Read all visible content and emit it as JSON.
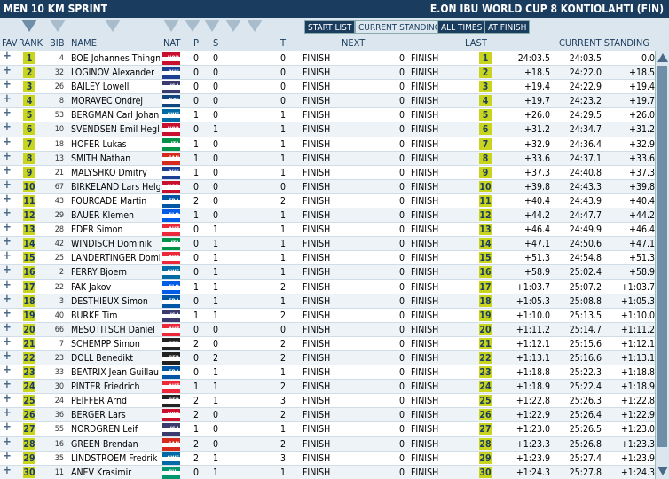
{
  "title_left": "MEN 10 KM SPRINT",
  "title_right": "E.ON IBU WORLD CUP 8 KONTIOLAHTI (FIN)",
  "tabs": [
    "START LIST",
    "CURRENT STANDING",
    "ALL TIMES",
    "AT FINISH"
  ],
  "columns": {
    "fav": "FAV",
    "rank": "RANK",
    "bib": "BIB",
    "name": "NAME",
    "nat": "NAT",
    "p": "P",
    "s": "S",
    "t": "T",
    "next": "NEXT",
    "last": "LAST",
    "current": "CURRENT STANDING"
  },
  "rows": [
    {
      "rank": "1",
      "bib": "4",
      "name": "BOE Johannes Thingn",
      "nat": "NOR",
      "p": "0",
      "s": "0",
      "t": "0",
      "next": "FINISH",
      "nv": "0",
      "last": "FINISH",
      "lrank": "1",
      "ltime": "24:03.5",
      "ctime": "24:03.5",
      "cdiff": "0.0"
    },
    {
      "rank": "2",
      "bib": "32",
      "name": "LOGINOV Alexander",
      "nat": "RUS",
      "p": "0",
      "s": "0",
      "t": "0",
      "next": "FINISH",
      "nv": "0",
      "last": "FINISH",
      "lrank": "2",
      "ltime": "+18.5",
      "ctime": "24:22.0",
      "cdiff": "+18.5"
    },
    {
      "rank": "3",
      "bib": "26",
      "name": "BAILEY Lowell",
      "nat": "USA",
      "p": "0",
      "s": "0",
      "t": "0",
      "next": "FINISH",
      "nv": "0",
      "last": "FINISH",
      "lrank": "3",
      "ltime": "+19.4",
      "ctime": "24:22.9",
      "cdiff": "+19.4"
    },
    {
      "rank": "4",
      "bib": "8",
      "name": "MORAVEC Ondrej",
      "nat": "CZE",
      "p": "0",
      "s": "0",
      "t": "0",
      "next": "FINISH",
      "nv": "0",
      "last": "FINISH",
      "lrank": "4",
      "ltime": "+19.7",
      "ctime": "24:23.2",
      "cdiff": "+19.7"
    },
    {
      "rank": "5",
      "bib": "53",
      "name": "BERGMAN Carl Johan",
      "nat": "SWE",
      "p": "1",
      "s": "0",
      "t": "1",
      "next": "FINISH",
      "nv": "0",
      "last": "FINISH",
      "lrank": "5",
      "ltime": "+26.0",
      "ctime": "24:29.5",
      "cdiff": "+26.0"
    },
    {
      "rank": "6",
      "bib": "10",
      "name": "SVENDSEN Emil Hegle",
      "nat": "NOR",
      "p": "0",
      "s": "1",
      "t": "1",
      "next": "FINISH",
      "nv": "0",
      "last": "FINISH",
      "lrank": "6",
      "ltime": "+31.2",
      "ctime": "24:34.7",
      "cdiff": "+31.2"
    },
    {
      "rank": "7",
      "bib": "18",
      "name": "HOFER Lukas",
      "nat": "ITA",
      "p": "1",
      "s": "0",
      "t": "1",
      "next": "FINISH",
      "nv": "0",
      "last": "FINISH",
      "lrank": "7",
      "ltime": "+32.9",
      "ctime": "24:36.4",
      "cdiff": "+32.9"
    },
    {
      "rank": "8",
      "bib": "13",
      "name": "SMITH Nathan",
      "nat": "CAN",
      "p": "1",
      "s": "0",
      "t": "1",
      "next": "FINISH",
      "nv": "0",
      "last": "FINISH",
      "lrank": "8",
      "ltime": "+33.6",
      "ctime": "24:37.1",
      "cdiff": "+33.6"
    },
    {
      "rank": "9",
      "bib": "21",
      "name": "MALYSHKO Dmitry",
      "nat": "RUS",
      "p": "1",
      "s": "0",
      "t": "1",
      "next": "FINISH",
      "nv": "0",
      "last": "FINISH",
      "lrank": "9",
      "ltime": "+37.3",
      "ctime": "24:40.8",
      "cdiff": "+37.3"
    },
    {
      "rank": "10",
      "bib": "67",
      "name": "BIRKELAND Lars Helg",
      "nat": "NOR",
      "p": "0",
      "s": "0",
      "t": "0",
      "next": "FINISH",
      "nv": "0",
      "last": "FINISH",
      "lrank": "10",
      "ltime": "+39.8",
      "ctime": "24:43.3",
      "cdiff": "+39.8"
    },
    {
      "rank": "11",
      "bib": "43",
      "name": "FOURCADE Martin",
      "nat": "FRA",
      "p": "2",
      "s": "0",
      "t": "2",
      "next": "FINISH",
      "nv": "0",
      "last": "FINISH",
      "lrank": "11",
      "ltime": "+40.4",
      "ctime": "24:43.9",
      "cdiff": "+40.4"
    },
    {
      "rank": "12",
      "bib": "29",
      "name": "BAUER Klemen",
      "nat": "SLO",
      "p": "1",
      "s": "0",
      "t": "1",
      "next": "FINISH",
      "nv": "0",
      "last": "FINISH",
      "lrank": "12",
      "ltime": "+44.2",
      "ctime": "24:47.7",
      "cdiff": "+44.2"
    },
    {
      "rank": "13",
      "bib": "28",
      "name": "EDER Simon",
      "nat": "AUT",
      "p": "0",
      "s": "1",
      "t": "1",
      "next": "FINISH",
      "nv": "0",
      "last": "FINISH",
      "lrank": "13",
      "ltime": "+46.4",
      "ctime": "24:49.9",
      "cdiff": "+46.4"
    },
    {
      "rank": "14",
      "bib": "42",
      "name": "WINDISCH Dominik",
      "nat": "ITA",
      "p": "0",
      "s": "1",
      "t": "1",
      "next": "FINISH",
      "nv": "0",
      "last": "FINISH",
      "lrank": "14",
      "ltime": "+47.1",
      "ctime": "24:50.6",
      "cdiff": "+47.1"
    },
    {
      "rank": "15",
      "bib": "25",
      "name": "LANDERTINGER Domir",
      "nat": "AUT",
      "p": "0",
      "s": "1",
      "t": "1",
      "next": "FINISH",
      "nv": "0",
      "last": "FINISH",
      "lrank": "15",
      "ltime": "+51.3",
      "ctime": "24:54.8",
      "cdiff": "+51.3"
    },
    {
      "rank": "16",
      "bib": "2",
      "name": "FERRY Bjoern",
      "nat": "SWE",
      "p": "0",
      "s": "1",
      "t": "1",
      "next": "FINISH",
      "nv": "0",
      "last": "FINISH",
      "lrank": "16",
      "ltime": "+58.9",
      "ctime": "25:02.4",
      "cdiff": "+58.9"
    },
    {
      "rank": "17",
      "bib": "22",
      "name": "FAK Jakov",
      "nat": "SLO",
      "p": "1",
      "s": "1",
      "t": "2",
      "next": "FINISH",
      "nv": "0",
      "last": "FINISH",
      "lrank": "17",
      "ltime": "+1:03.7",
      "ctime": "25:07.2",
      "cdiff": "+1:03.7"
    },
    {
      "rank": "18",
      "bib": "3",
      "name": "DESTHIEUX Simon",
      "nat": "FRA",
      "p": "0",
      "s": "1",
      "t": "1",
      "next": "FINISH",
      "nv": "0",
      "last": "FINISH",
      "lrank": "18",
      "ltime": "+1:05.3",
      "ctime": "25:08.8",
      "cdiff": "+1:05.3"
    },
    {
      "rank": "19",
      "bib": "40",
      "name": "BURKE Tim",
      "nat": "USA",
      "p": "1",
      "s": "1",
      "t": "2",
      "next": "FINISH",
      "nv": "0",
      "last": "FINISH",
      "lrank": "19",
      "ltime": "+1:10.0",
      "ctime": "25:13.5",
      "cdiff": "+1:10.0"
    },
    {
      "rank": "20",
      "bib": "66",
      "name": "MESOTITSCH Daniel",
      "nat": "AUT",
      "p": "0",
      "s": "0",
      "t": "0",
      "next": "FINISH",
      "nv": "0",
      "last": "FINISH",
      "lrank": "20",
      "ltime": "+1:11.2",
      "ctime": "25:14.7",
      "cdiff": "+1:11.2"
    },
    {
      "rank": "21",
      "bib": "7",
      "name": "SCHEMPP Simon",
      "nat": "GER",
      "p": "2",
      "s": "0",
      "t": "2",
      "next": "FINISH",
      "nv": "0",
      "last": "FINISH",
      "lrank": "21",
      "ltime": "+1:12.1",
      "ctime": "25:15.6",
      "cdiff": "+1:12.1"
    },
    {
      "rank": "22",
      "bib": "23",
      "name": "DOLL Benedikt",
      "nat": "GER",
      "p": "0",
      "s": "2",
      "t": "2",
      "next": "FINISH",
      "nv": "0",
      "last": "FINISH",
      "lrank": "22",
      "ltime": "+1:13.1",
      "ctime": "25:16.6",
      "cdiff": "+1:13.1"
    },
    {
      "rank": "23",
      "bib": "33",
      "name": "BEATRIX Jean Guillau",
      "nat": "FRA",
      "p": "0",
      "s": "1",
      "t": "1",
      "next": "FINISH",
      "nv": "0",
      "last": "FINISH",
      "lrank": "23",
      "ltime": "+1:18.8",
      "ctime": "25:22.3",
      "cdiff": "+1:18.8"
    },
    {
      "rank": "24",
      "bib": "30",
      "name": "PINTER Friedrich",
      "nat": "AUT",
      "p": "1",
      "s": "1",
      "t": "2",
      "next": "FINISH",
      "nv": "0",
      "last": "FINISH",
      "lrank": "24",
      "ltime": "+1:18.9",
      "ctime": "25:22.4",
      "cdiff": "+1:18.9"
    },
    {
      "rank": "25",
      "bib": "24",
      "name": "PEIFFER Arnd",
      "nat": "GER",
      "p": "2",
      "s": "1",
      "t": "3",
      "next": "FINISH",
      "nv": "0",
      "last": "FINISH",
      "lrank": "25",
      "ltime": "+1:22.8",
      "ctime": "25:26.3",
      "cdiff": "+1:22.8"
    },
    {
      "rank": "26",
      "bib": "36",
      "name": "BERGER Lars",
      "nat": "NOR",
      "p": "2",
      "s": "0",
      "t": "2",
      "next": "FINISH",
      "nv": "0",
      "last": "FINISH",
      "lrank": "26",
      "ltime": "+1:22.9",
      "ctime": "25:26.4",
      "cdiff": "+1:22.9"
    },
    {
      "rank": "27",
      "bib": "55",
      "name": "NORDGREN Leif",
      "nat": "USA",
      "p": "1",
      "s": "0",
      "t": "1",
      "next": "FINISH",
      "nv": "0",
      "last": "FINISH",
      "lrank": "27",
      "ltime": "+1:23.0",
      "ctime": "25:26.5",
      "cdiff": "+1:23.0"
    },
    {
      "rank": "28",
      "bib": "16",
      "name": "GREEN Brendan",
      "nat": "CAN",
      "p": "2",
      "s": "0",
      "t": "2",
      "next": "FINISH",
      "nv": "0",
      "last": "FINISH",
      "lrank": "28",
      "ltime": "+1:23.3",
      "ctime": "25:26.8",
      "cdiff": "+1:23.3"
    },
    {
      "rank": "29",
      "bib": "35",
      "name": "LINDSTROEM Fredrik",
      "nat": "SWE",
      "p": "2",
      "s": "1",
      "t": "3",
      "next": "FINISH",
      "nv": "0",
      "last": "FINISH",
      "lrank": "29",
      "ltime": "+1:23.9",
      "ctime": "25:27.4",
      "cdiff": "+1:23.9"
    },
    {
      "rank": "30",
      "bib": "11",
      "name": "ANEV Krasimir",
      "nat": "BUL",
      "p": "0",
      "s": "1",
      "t": "1",
      "next": "FINISH",
      "nv": "0",
      "last": "FINISH",
      "lrank": "30",
      "ltime": "+1:24.3",
      "ctime": "25:27.8",
      "cdiff": "+1:24.3"
    }
  ]
}
